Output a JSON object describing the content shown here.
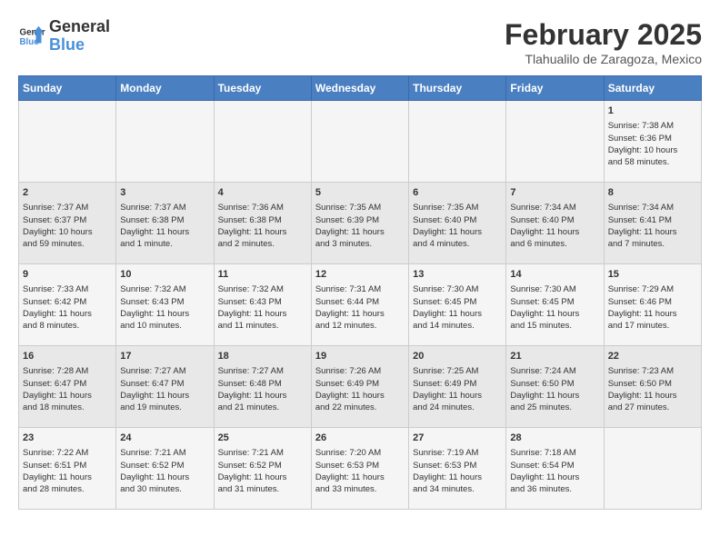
{
  "header": {
    "logo": {
      "line1": "General",
      "line2": "Blue"
    },
    "title": "February 2025",
    "subtitle": "Tlahualilo de Zaragoza, Mexico"
  },
  "calendar": {
    "days_of_week": [
      "Sunday",
      "Monday",
      "Tuesday",
      "Wednesday",
      "Thursday",
      "Friday",
      "Saturday"
    ],
    "weeks": [
      [
        {
          "day": "",
          "info": ""
        },
        {
          "day": "",
          "info": ""
        },
        {
          "day": "",
          "info": ""
        },
        {
          "day": "",
          "info": ""
        },
        {
          "day": "",
          "info": ""
        },
        {
          "day": "",
          "info": ""
        },
        {
          "day": "1",
          "info": "Sunrise: 7:38 AM\nSunset: 6:36 PM\nDaylight: 10 hours\nand 58 minutes."
        }
      ],
      [
        {
          "day": "2",
          "info": "Sunrise: 7:37 AM\nSunset: 6:37 PM\nDaylight: 10 hours\nand 59 minutes."
        },
        {
          "day": "3",
          "info": "Sunrise: 7:37 AM\nSunset: 6:38 PM\nDaylight: 11 hours\nand 1 minute."
        },
        {
          "day": "4",
          "info": "Sunrise: 7:36 AM\nSunset: 6:38 PM\nDaylight: 11 hours\nand 2 minutes."
        },
        {
          "day": "5",
          "info": "Sunrise: 7:35 AM\nSunset: 6:39 PM\nDaylight: 11 hours\nand 3 minutes."
        },
        {
          "day": "6",
          "info": "Sunrise: 7:35 AM\nSunset: 6:40 PM\nDaylight: 11 hours\nand 4 minutes."
        },
        {
          "day": "7",
          "info": "Sunrise: 7:34 AM\nSunset: 6:40 PM\nDaylight: 11 hours\nand 6 minutes."
        },
        {
          "day": "8",
          "info": "Sunrise: 7:34 AM\nSunset: 6:41 PM\nDaylight: 11 hours\nand 7 minutes."
        }
      ],
      [
        {
          "day": "9",
          "info": "Sunrise: 7:33 AM\nSunset: 6:42 PM\nDaylight: 11 hours\nand 8 minutes."
        },
        {
          "day": "10",
          "info": "Sunrise: 7:32 AM\nSunset: 6:43 PM\nDaylight: 11 hours\nand 10 minutes."
        },
        {
          "day": "11",
          "info": "Sunrise: 7:32 AM\nSunset: 6:43 PM\nDaylight: 11 hours\nand 11 minutes."
        },
        {
          "day": "12",
          "info": "Sunrise: 7:31 AM\nSunset: 6:44 PM\nDaylight: 11 hours\nand 12 minutes."
        },
        {
          "day": "13",
          "info": "Sunrise: 7:30 AM\nSunset: 6:45 PM\nDaylight: 11 hours\nand 14 minutes."
        },
        {
          "day": "14",
          "info": "Sunrise: 7:30 AM\nSunset: 6:45 PM\nDaylight: 11 hours\nand 15 minutes."
        },
        {
          "day": "15",
          "info": "Sunrise: 7:29 AM\nSunset: 6:46 PM\nDaylight: 11 hours\nand 17 minutes."
        }
      ],
      [
        {
          "day": "16",
          "info": "Sunrise: 7:28 AM\nSunset: 6:47 PM\nDaylight: 11 hours\nand 18 minutes."
        },
        {
          "day": "17",
          "info": "Sunrise: 7:27 AM\nSunset: 6:47 PM\nDaylight: 11 hours\nand 19 minutes."
        },
        {
          "day": "18",
          "info": "Sunrise: 7:27 AM\nSunset: 6:48 PM\nDaylight: 11 hours\nand 21 minutes."
        },
        {
          "day": "19",
          "info": "Sunrise: 7:26 AM\nSunset: 6:49 PM\nDaylight: 11 hours\nand 22 minutes."
        },
        {
          "day": "20",
          "info": "Sunrise: 7:25 AM\nSunset: 6:49 PM\nDaylight: 11 hours\nand 24 minutes."
        },
        {
          "day": "21",
          "info": "Sunrise: 7:24 AM\nSunset: 6:50 PM\nDaylight: 11 hours\nand 25 minutes."
        },
        {
          "day": "22",
          "info": "Sunrise: 7:23 AM\nSunset: 6:50 PM\nDaylight: 11 hours\nand 27 minutes."
        }
      ],
      [
        {
          "day": "23",
          "info": "Sunrise: 7:22 AM\nSunset: 6:51 PM\nDaylight: 11 hours\nand 28 minutes."
        },
        {
          "day": "24",
          "info": "Sunrise: 7:21 AM\nSunset: 6:52 PM\nDaylight: 11 hours\nand 30 minutes."
        },
        {
          "day": "25",
          "info": "Sunrise: 7:21 AM\nSunset: 6:52 PM\nDaylight: 11 hours\nand 31 minutes."
        },
        {
          "day": "26",
          "info": "Sunrise: 7:20 AM\nSunset: 6:53 PM\nDaylight: 11 hours\nand 33 minutes."
        },
        {
          "day": "27",
          "info": "Sunrise: 7:19 AM\nSunset: 6:53 PM\nDaylight: 11 hours\nand 34 minutes."
        },
        {
          "day": "28",
          "info": "Sunrise: 7:18 AM\nSunset: 6:54 PM\nDaylight: 11 hours\nand 36 minutes."
        },
        {
          "day": "",
          "info": ""
        }
      ]
    ]
  }
}
